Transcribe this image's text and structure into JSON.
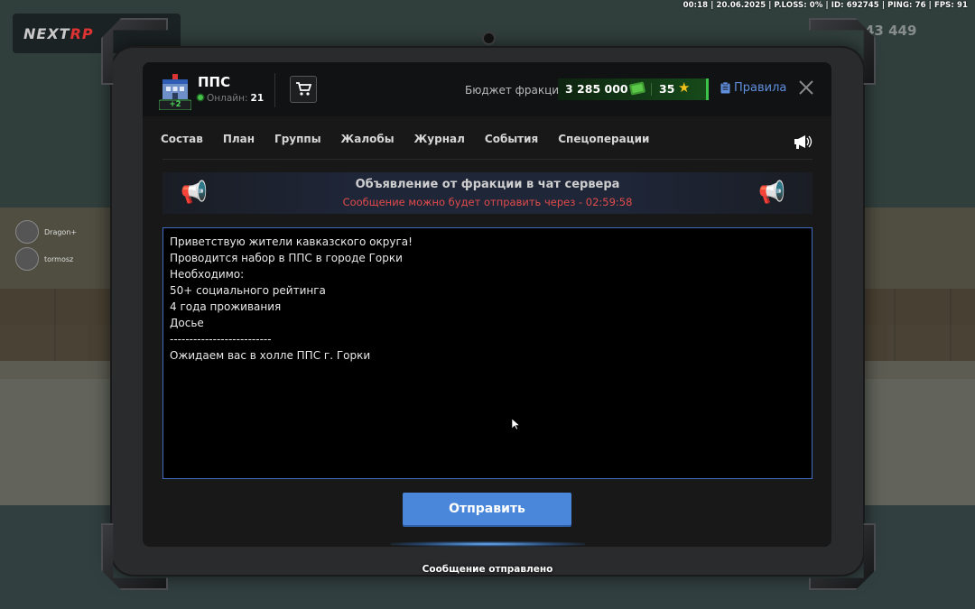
{
  "hud": {
    "top_status": "00:18 | 20.06.2025 | P.LOSS: 0% | ID: 692745 | PING: 76 | FPS: 91"
  },
  "background": {
    "logo_main": "NEXT",
    "logo_rp": "RP",
    "players": [
      {
        "name": "Dragon+"
      },
      {
        "name": "tormosz"
      }
    ],
    "right_money": "43 449"
  },
  "faction": {
    "title": "ППС",
    "badge": "+2",
    "online_label": "Онлайн:",
    "online_count": "21"
  },
  "budget": {
    "label": "Бюджет фракции:",
    "value": "3 285 000",
    "stars": "35"
  },
  "rules_label": "Правила",
  "tabs": [
    "Состав",
    "План",
    "Группы",
    "Жалобы",
    "Журнал",
    "События",
    "Спецоперации"
  ],
  "announcement": {
    "title": "Объявление от фракции в чат сервера",
    "cooldown": "Сообщение можно будет отправить через - 02:59:58"
  },
  "message_lines": [
    "Приветствую жители кавказского округа!",
    "Проводится набор в ППС в городе Горки",
    "Необходимо:",
    "50+ социального рейтинга",
    "4 года проживания",
    "Досье",
    "--------------------------",
    "Ожидаем вас в холле ППС г. Горки"
  ],
  "send_label": "Отправить",
  "status_message": "Сообщение отправлено",
  "colors": {
    "accent_blue": "#4a86d9",
    "budget_green": "#3cc44a",
    "cooldown_red": "#e04b4b",
    "star_gold": "#f2c21b"
  }
}
